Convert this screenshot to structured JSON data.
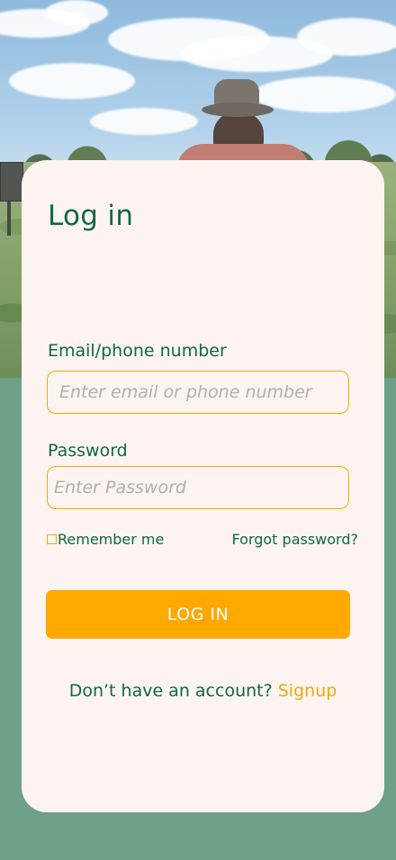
{
  "login": {
    "title": "Log in",
    "email_label": "Email/phone number",
    "email_placeholder": "Enter email or phone number",
    "password_label": "Password",
    "password_placeholder": "Enter Password",
    "remember_label": "Remember me",
    "forgot_label": "Forgot password?",
    "submit_label": "LOG IN",
    "signup_prompt": "Don’t have an account?",
    "signup_link": "Signup"
  },
  "colors": {
    "primary_green": "#0e6a40",
    "accent_orange": "#ffa800",
    "card_background": "#fdf4f2",
    "page_background_green": "#6fa088"
  },
  "icons": {
    "remember_checkbox": "checkbox-unchecked"
  }
}
